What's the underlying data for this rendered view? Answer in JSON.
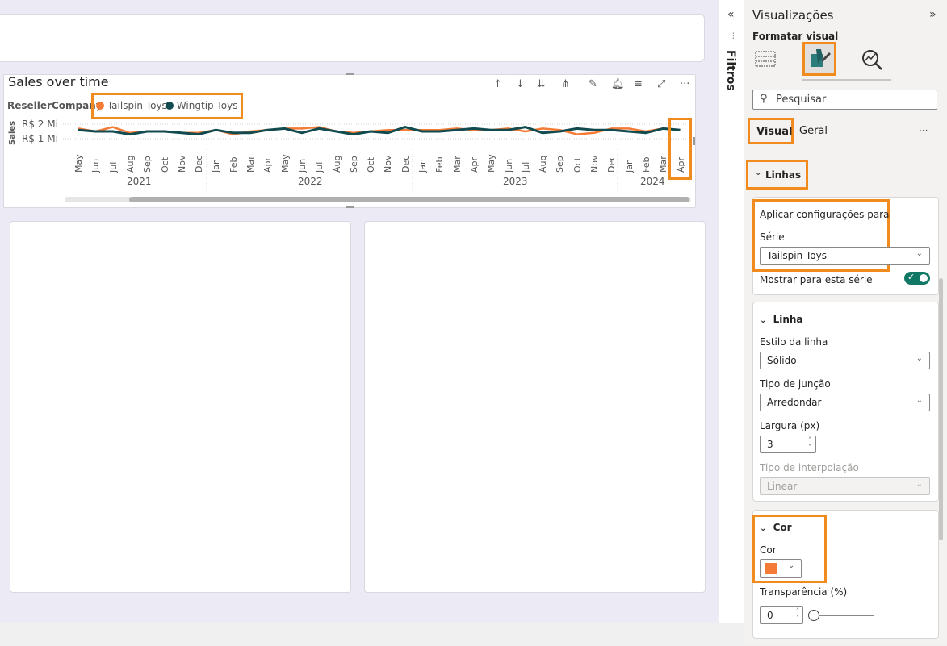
{
  "report": {
    "chart_title": "Sales over time",
    "legend_title": "ResellerCompany",
    "legend_items": [
      {
        "label": "Tailspin Toys",
        "color": "#f47b36"
      },
      {
        "label": "Wingtip Toys",
        "color": "#114a4f"
      }
    ],
    "y_axis_title": "Sales",
    "y_ticks": [
      "R$ 2 Mi",
      "R$ 1 Mi"
    ],
    "months": [
      "May",
      "Jun",
      "Jul",
      "Aug",
      "Sep",
      "Oct",
      "Nov",
      "Dec",
      "Jan",
      "Feb",
      "Mar",
      "Apr",
      "May",
      "Jun",
      "Jul",
      "Aug",
      "Sep",
      "Oct",
      "Nov",
      "Dec",
      "Jan",
      "Feb",
      "Mar",
      "Apr",
      "May",
      "Jun",
      "Jul",
      "Aug",
      "Sep",
      "Oct",
      "Nov",
      "Dec",
      "Jan",
      "Feb",
      "Mar",
      "Apr"
    ],
    "years": [
      "2021",
      "2022",
      "2023",
      "2024"
    ]
  },
  "chart_data": {
    "type": "line",
    "title": "Sales over time",
    "ylabel": "Sales",
    "x": [
      "May 2021",
      "Jun 2021",
      "Jul 2021",
      "Aug 2021",
      "Sep 2021",
      "Oct 2021",
      "Nov 2021",
      "Dec 2021",
      "Jan 2022",
      "Feb 2022",
      "Mar 2022",
      "Apr 2022",
      "May 2022",
      "Jun 2022",
      "Jul 2022",
      "Aug 2022",
      "Sep 2022",
      "Oct 2022",
      "Nov 2022",
      "Dec 2022",
      "Jan 2023",
      "Feb 2023",
      "Mar 2023",
      "Apr 2023",
      "May 2023",
      "Jun 2023",
      "Jul 2023",
      "Aug 2023",
      "Sep 2023",
      "Oct 2023",
      "Nov 2023",
      "Dec 2023",
      "Jan 2024",
      "Feb 2024",
      "Mar 2024",
      "Apr 2024"
    ],
    "series": [
      {
        "name": "Tailspin Toys",
        "color": "#f47b36",
        "values": [
          1.7,
          1.5,
          1.8,
          1.4,
          1.5,
          1.5,
          1.4,
          1.4,
          1.6,
          1.3,
          1.5,
          1.6,
          1.7,
          1.7,
          1.8,
          1.5,
          1.4,
          1.5,
          1.6,
          1.6,
          1.6,
          1.6,
          1.7,
          1.6,
          1.6,
          1.7,
          1.5,
          1.7,
          1.6,
          1.3,
          1.4,
          1.7,
          1.7,
          1.5,
          1.7,
          1.6
        ]
      },
      {
        "name": "Wingtip Toys",
        "color": "#114a4f",
        "values": [
          1.6,
          1.5,
          1.5,
          1.3,
          1.5,
          1.5,
          1.4,
          1.3,
          1.6,
          1.4,
          1.4,
          1.6,
          1.7,
          1.4,
          1.7,
          1.5,
          1.3,
          1.5,
          1.4,
          1.8,
          1.5,
          1.5,
          1.6,
          1.7,
          1.6,
          1.6,
          1.8,
          1.4,
          1.5,
          1.7,
          1.6,
          1.6,
          1.5,
          1.4,
          1.7,
          1.6
        ]
      }
    ],
    "ylim": [
      0,
      2.5
    ],
    "legend": "top-left"
  },
  "filters": {
    "label": "Filtros"
  },
  "pane": {
    "title": "Visualizações",
    "subtitle": "Formatar visual",
    "search_placeholder": "Pesquisar",
    "tabs": [
      "Visual",
      "Geral"
    ],
    "more": "···",
    "section_lines": "Linhas",
    "apply_title": "Aplicar configurações para",
    "serie_label": "Série",
    "serie_value": "Tailspin Toys",
    "show_series_label": "Mostrar para esta série",
    "line_section": "Linha",
    "style_label": "Estilo da linha",
    "style_value": "Sólido",
    "join_label": "Tipo de junção",
    "join_value": "Arredondar",
    "width_label": "Largura (px)",
    "width_value": "3",
    "interp_label": "Tipo de interpolação",
    "interp_value": "Linear",
    "color_section": "Cor",
    "color_label": "Cor",
    "color_value": "#f47b36",
    "transparency_label": "Transparência (%)",
    "transparency_value": "0"
  }
}
